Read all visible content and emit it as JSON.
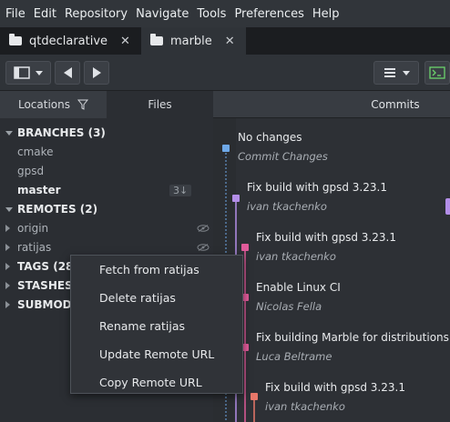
{
  "menu": [
    "File",
    "Edit",
    "Repository",
    "Navigate",
    "Tools",
    "Preferences",
    "Help"
  ],
  "tabs": [
    {
      "label": "qtdeclarative",
      "close": "✕",
      "icon_color": "#e6e8ea"
    },
    {
      "label": "marble",
      "close": "✕",
      "icon_color": "#e6e8ea"
    }
  ],
  "sidebar": {
    "tabs": {
      "locations": "Locations",
      "files": "Files"
    },
    "branches_header": "BRANCHES (3)",
    "branches": [
      "cmake",
      "gpsd",
      "master"
    ],
    "master_badge": "3↓",
    "remotes_header": "REMOTES (2)",
    "remotes": [
      "origin",
      "ratijas"
    ],
    "tags_header": "TAGS (284",
    "stashes_header": "STASHES (",
    "submodules_header": "SUBMODU"
  },
  "commits": {
    "header": "Commits",
    "items": [
      {
        "message": "No changes",
        "author": "Commit Changes",
        "node_color": "#6ea8e8"
      },
      {
        "message": "Fix build with gpsd 3.23.1",
        "author": "ivan tkachenko",
        "node_color": "#b38ee8"
      },
      {
        "message": "Fix build with gpsd 3.23.1",
        "author": "ivan tkachenko",
        "node_color": "#e05b9a"
      },
      {
        "message": "Enable Linux CI",
        "author": "Nicolas Fella",
        "node_color": "#e05b9a"
      },
      {
        "message": "Fix building Marble for distributions",
        "author": "Luca Beltrame",
        "node_color": "#e05b9a"
      },
      {
        "message": "Fix build with gpsd 3.23.1",
        "author": "ivan tkachenko",
        "node_color": "#e8786a"
      }
    ]
  },
  "context_menu": {
    "items": [
      "Fetch from ratijas",
      "Delete ratijas",
      "Rename ratijas",
      "Update Remote URL",
      "Copy Remote URL"
    ]
  },
  "colors": {
    "lane_purple": "#b38ee8",
    "lane_pink": "#e05b9a",
    "lane_blue": "#6ea8e8",
    "lane_orange": "#e8786a",
    "terminal_green": "#6bd36b"
  }
}
